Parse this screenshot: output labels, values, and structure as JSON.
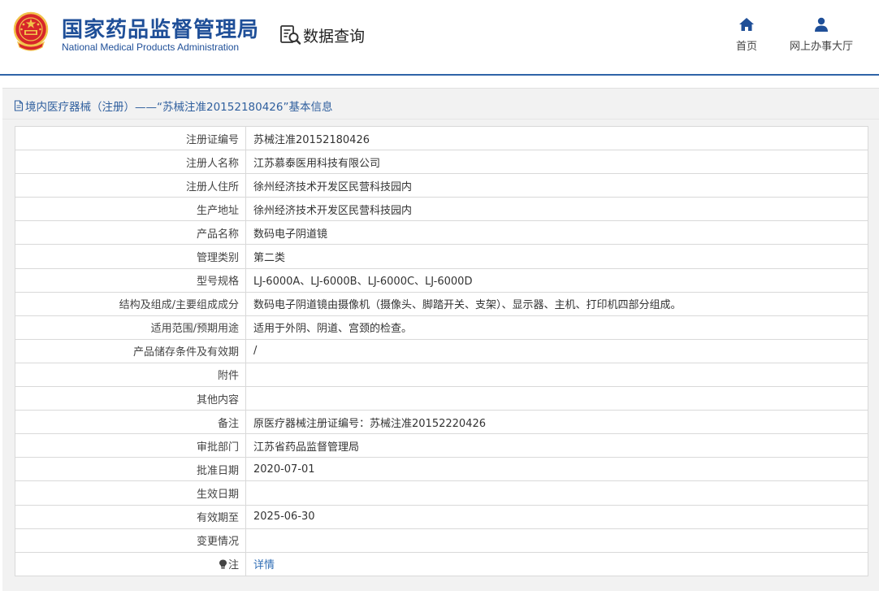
{
  "header": {
    "org_cn": "国家药品监督管理局",
    "org_en": "National Medical Products Administration",
    "query_label": "数据查询",
    "nav": {
      "home_label": "首页",
      "hall_label": "网上办事大厅"
    }
  },
  "colors": {
    "brand_blue": "#1f4f98",
    "header_line": "#2f64a8",
    "link_blue": "#2f6db5",
    "panel_bg": "#f2f2f2",
    "emblem_red": "#d7262a",
    "emblem_gold": "#f2c24a"
  },
  "icons": {
    "emblem": "national-emblem-icon",
    "query": "search-document-icon",
    "home": "home-icon",
    "hall": "user-icon",
    "doc": "document-icon",
    "note": "lightbulb-icon"
  },
  "panel": {
    "title": "境内医疗器械（注册）——“苏械注准20152180426”基本信息"
  },
  "rows": [
    {
      "label": "注册证编号",
      "value": "苏械注准20152180426"
    },
    {
      "label": "注册人名称",
      "value": "江苏慕泰医用科技有限公司"
    },
    {
      "label": "注册人住所",
      "value": "徐州经济技术开发区民营科技园内"
    },
    {
      "label": "生产地址",
      "value": "徐州经济技术开发区民营科技园内"
    },
    {
      "label": "产品名称",
      "value": "数码电子阴道镜"
    },
    {
      "label": "管理类别",
      "value": "第二类"
    },
    {
      "label": "型号规格",
      "value": "LJ-6000A、LJ-6000B、LJ-6000C、LJ-6000D"
    },
    {
      "label": "结构及组成/主要组成成分",
      "value": "数码电子阴道镜由摄像机（摄像头、脚踏开关、支架）、显示器、主机、打印机四部分组成。"
    },
    {
      "label": "适用范围/预期用途",
      "value": "适用于外阴、阴道、宫颈的检查。"
    },
    {
      "label": "产品储存条件及有效期",
      "value": "/"
    },
    {
      "label": "附件",
      "value": ""
    },
    {
      "label": "其他内容",
      "value": ""
    },
    {
      "label": "备注",
      "value": "原医疗器械注册证编号：苏械注准20152220426"
    },
    {
      "label": "审批部门",
      "value": "江苏省药品监督管理局"
    },
    {
      "label": "批准日期",
      "value": "2020-07-01"
    },
    {
      "label": "生效日期",
      "value": ""
    },
    {
      "label": "有效期至",
      "value": "2025-06-30"
    },
    {
      "label": "变更情况",
      "value": ""
    }
  ],
  "note_row": {
    "label": "注",
    "link": "详情"
  }
}
